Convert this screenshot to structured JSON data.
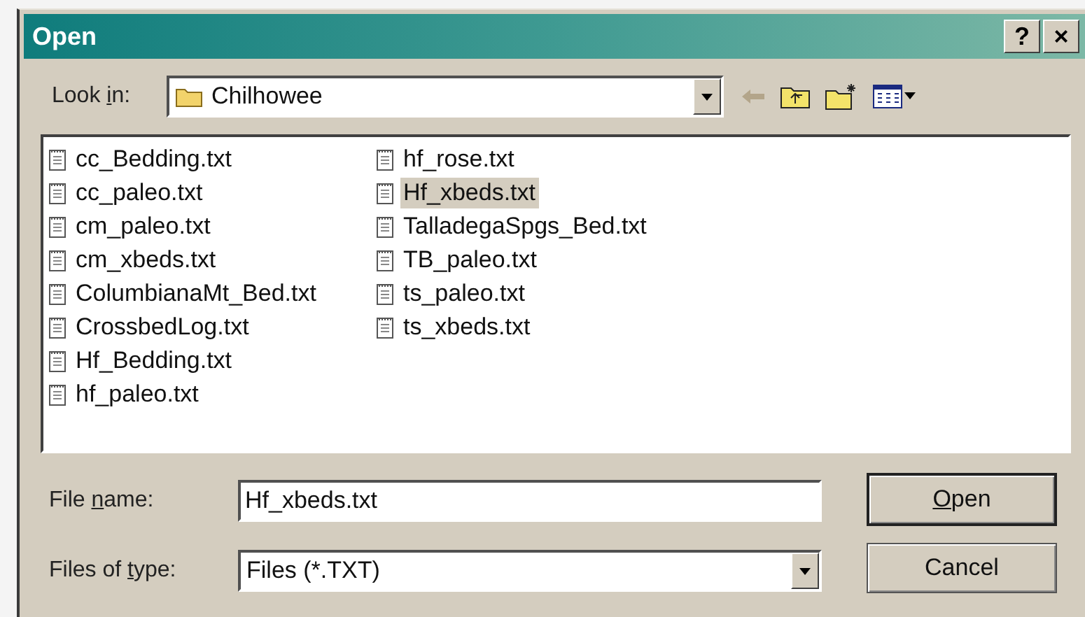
{
  "window": {
    "title": "Open",
    "help_button": "?",
    "close_button": "×"
  },
  "look_in": {
    "label": {
      "pre": "Look ",
      "key": "i",
      "post": "n:"
    },
    "value": "Chilhowee"
  },
  "files": [
    {
      "name": "cc_Bedding.txt",
      "selected": false
    },
    {
      "name": "cc_paleo.txt",
      "selected": false
    },
    {
      "name": "cm_paleo.txt",
      "selected": false
    },
    {
      "name": "cm_xbeds.txt",
      "selected": false
    },
    {
      "name": "ColumbianaMt_Bed.txt",
      "selected": false
    },
    {
      "name": "CrossbedLog.txt",
      "selected": false
    },
    {
      "name": "Hf_Bedding.txt",
      "selected": false
    },
    {
      "name": "hf_paleo.txt",
      "selected": false
    },
    {
      "name": "hf_rose.txt",
      "selected": false
    },
    {
      "name": "Hf_xbeds.txt",
      "selected": true
    },
    {
      "name": "TalladegaSpgs_Bed.txt",
      "selected": false
    },
    {
      "name": "TB_paleo.txt",
      "selected": false
    },
    {
      "name": "ts_paleo.txt",
      "selected": false
    },
    {
      "name": "ts_xbeds.txt",
      "selected": false
    }
  ],
  "file_name": {
    "label": {
      "pre": "File ",
      "key": "n",
      "post": "ame:"
    },
    "value": "Hf_xbeds.txt"
  },
  "file_type": {
    "label": {
      "pre": "Files of ",
      "key": "t",
      "post": "ype:"
    },
    "value": "Files (*.TXT)"
  },
  "buttons": [
    {
      "key": "O",
      "post": "pen",
      "default": true
    },
    {
      "pre": "Cancel",
      "default": false
    }
  ]
}
